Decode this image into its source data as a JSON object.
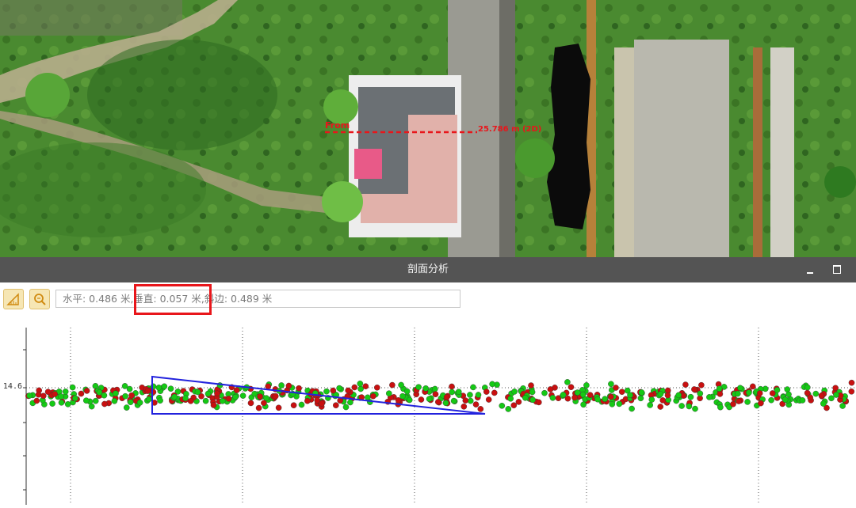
{
  "window": {
    "title": "剖面分析",
    "minimize_label": "_",
    "maximize_label": "□"
  },
  "map": {
    "from_label": "From",
    "distance_label": "25.786 m (2D)",
    "line_color": "#e8161b"
  },
  "toolbar": {
    "ruler_icon": "ruler-triangle-icon",
    "zoom_icon": "magnifier-icon",
    "measure_text": "水平: 0.486 米,垂直: 0.057 米,斜边: 0.489 米"
  },
  "profile": {
    "y_tick_label": "14.6",
    "point_colors": [
      "#15c915",
      "#c81010"
    ],
    "triangle_color": "#2222dd",
    "highlight_color": "#e8161b"
  },
  "chart_data": {
    "type": "scatter",
    "title": "",
    "xlabel": "",
    "ylabel": "",
    "y_ticks": [
      "14.6"
    ],
    "grid": true,
    "series": [
      {
        "color": "#15c915"
      },
      {
        "color": "#c81010"
      }
    ]
  }
}
